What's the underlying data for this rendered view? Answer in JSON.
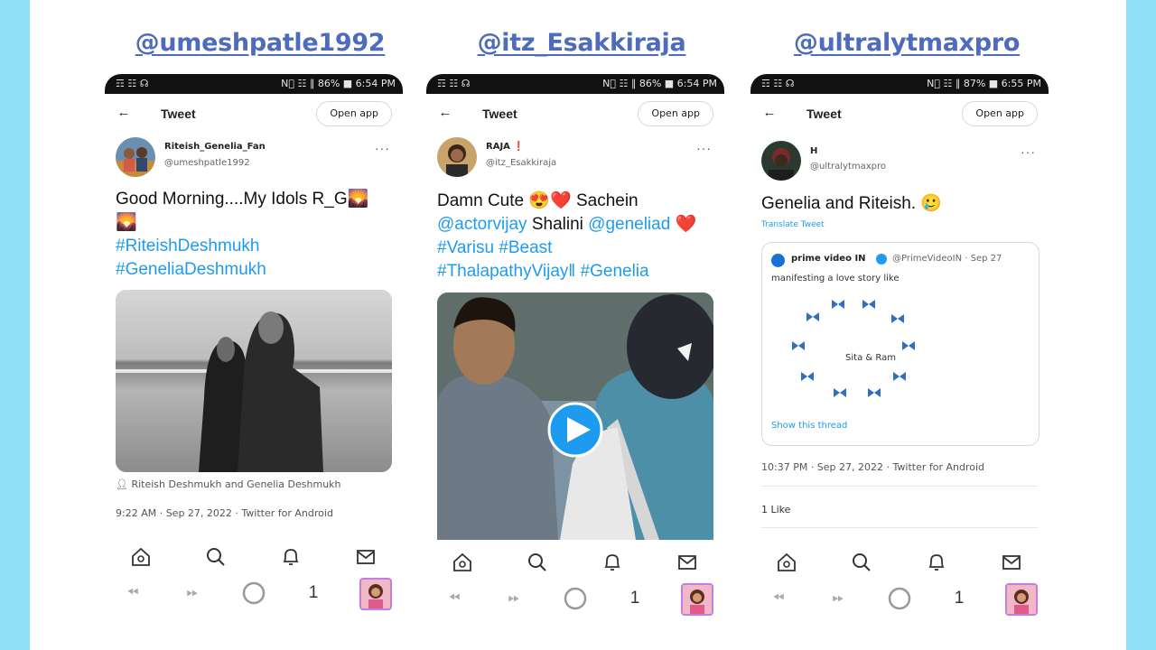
{
  "columns": [
    {
      "heading": "@umeshpatle1992",
      "status": {
        "left": "☶ ☷ ☊",
        "right": "N⃠ ☷ ∥ 86% ■ 6:54 PM"
      },
      "header": {
        "title": "Tweet",
        "open_app": "Open app"
      },
      "tweet": {
        "name": "Riteish_Genelia_Fan",
        "handle": "@umeshpatle1992",
        "text_plain": "Good Morning....My Idols R_G🌄 🌄",
        "tags": [
          "#RiteishDeshmukh",
          "#GeneliaDeshmukh"
        ],
        "photo_tag": "Riteish Deshmukh and Genelia Deshmukh",
        "timestamp": "9:22 AM · Sep 27, 2022 · Twitter for Android"
      }
    },
    {
      "heading": "@itz_Esakkiraja",
      "status": {
        "left": "☶ ☷ ☊",
        "right": "N⃠ ☷ ∥ 86% ■ 6:54 PM"
      },
      "header": {
        "title": "Tweet",
        "open_app": "Open app"
      },
      "tweet": {
        "name": "RAJA ❗",
        "handle": "@itz_Esakkiraja",
        "line1": "Damn Cute 😍❤️ Sachein",
        "line2_tag1": "@actorvijay",
        "line2_mid": " Shalini ",
        "line2_tag2": "@geneliad",
        "line2_heart": " ❤️",
        "line3": "#Varisu #Beast",
        "line4": "#ThalapathyVijay‖ #Genelia"
      }
    },
    {
      "heading": "@ultralytmaxpro",
      "status": {
        "left": "☶ ☷ ☊",
        "right": "N⃠ ☷ ∥ 87% ■ 6:55 PM"
      },
      "header": {
        "title": "Tweet",
        "open_app": "Open app"
      },
      "tweet": {
        "name": "H",
        "handle": "@ultralytmaxpro",
        "text": "Genelia and Riteish. 🥲",
        "translate": "Translate Tweet",
        "quote": {
          "name": "prime video IN",
          "handle_date": "@PrimeVideoIN · Sep 27",
          "text": "manifesting a love story like",
          "center": "Sita & Ram",
          "show_thread": "Show this thread"
        },
        "timestamp": "10:37 PM · Sep 27, 2022 · Twitter for Android",
        "likes": "1 Like"
      }
    }
  ],
  "nav": {
    "count": "1"
  },
  "colors": {
    "accent": "#1d9bf0",
    "sidebar": "#8fdff7",
    "heading": "#4e6bbd"
  }
}
